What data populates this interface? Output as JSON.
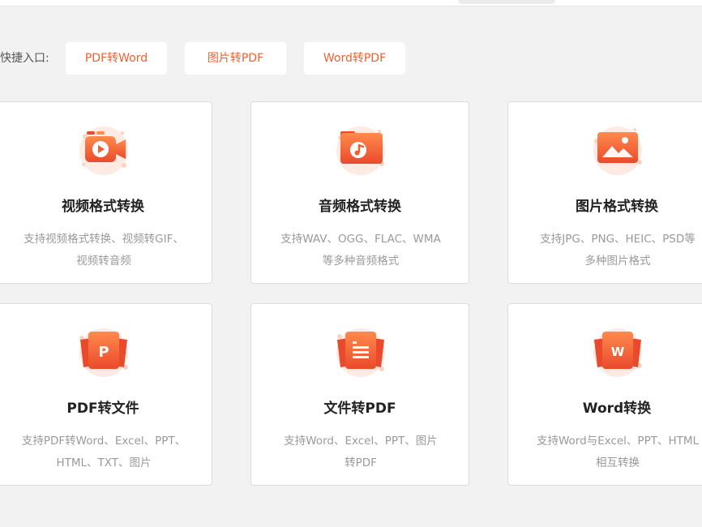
{
  "quick_entry": {
    "label": "快捷入口:",
    "buttons": [
      "PDF转Word",
      "图片转PDF",
      "Word转PDF"
    ]
  },
  "cards": [
    {
      "icon": "video-camera-icon",
      "title": "视频格式转换",
      "desc": [
        "支持视频格式转换、视频转GIF、",
        "视频转音频"
      ]
    },
    {
      "icon": "music-note-icon",
      "title": "音频格式转换",
      "desc": [
        "支持WAV、OGG、FLAC、WMA",
        "等多种音频格式"
      ]
    },
    {
      "icon": "image-icon",
      "title": "图片格式转换",
      "desc": [
        "支持JPG、PNG、HEIC、PSD等",
        "多种图片格式"
      ]
    },
    {
      "icon": "pdf-file-icon",
      "title": "PDF转文件",
      "desc": [
        "支持PDF转Word、Excel、PPT、",
        "HTML、TXT、图片"
      ]
    },
    {
      "icon": "document-icon",
      "title": "文件转PDF",
      "desc": [
        "支持Word、Excel、PPT、图片",
        "转PDF"
      ]
    },
    {
      "icon": "word-file-icon",
      "title": "Word转换",
      "desc": [
        "支持Word与Excel、PPT、HTML",
        "相互转换"
      ]
    }
  ],
  "colors": {
    "accent": "#f25f2c",
    "icon_gradient_top": "#ff8a4c",
    "icon_gradient_bottom": "#ea4a2c",
    "background": "#f2f2f2"
  }
}
